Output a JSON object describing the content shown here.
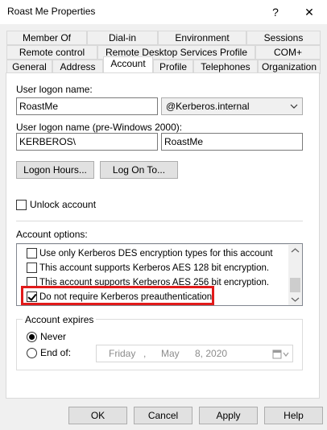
{
  "window": {
    "title": "Roast Me Properties",
    "help_glyph": "?",
    "close_glyph": "✕"
  },
  "tabs": {
    "row1": [
      "Member Of",
      "Dial-in",
      "Environment",
      "Sessions"
    ],
    "row2": [
      "Remote control",
      "Remote Desktop Services Profile",
      "COM+"
    ],
    "row3": [
      "General",
      "Address",
      "Account",
      "Profile",
      "Telephones",
      "Organization"
    ],
    "active": "Account"
  },
  "account": {
    "logon_name_label": "User logon name:",
    "logon_name_value": "RoastMe",
    "domain_value": "@Kerberos.internal",
    "pre2000_label": "User logon name (pre-Windows 2000):",
    "pre2000_domain": "KERBEROS\\",
    "pre2000_user": "RoastMe",
    "logon_hours_button": "Logon Hours...",
    "log_on_to_button": "Log On To...",
    "unlock_label": "Unlock account",
    "unlock_checked": false,
    "options_label": "Account options:",
    "options": [
      {
        "label": "Use only Kerberos DES encryption types for this account",
        "checked": false
      },
      {
        "label": "This account supports Kerberos AES 128 bit encryption.",
        "checked": false
      },
      {
        "label": "This account supports Kerberos AES 256 bit encryption.",
        "checked": false
      },
      {
        "label": "Do not require Kerberos preauthentication",
        "checked": true
      }
    ],
    "expires_label": "Account expires",
    "never_label": "Never",
    "never_selected": true,
    "end_of_label": "End of:",
    "end_date": {
      "weekday": "Friday",
      "sep": ",",
      "month": "May",
      "day": "8, 2020"
    }
  },
  "footer": {
    "ok": "OK",
    "cancel": "Cancel",
    "apply": "Apply",
    "help": "Help"
  },
  "colors": {
    "highlight": "#e11a1a",
    "window_bg": "#f0f0f0"
  }
}
